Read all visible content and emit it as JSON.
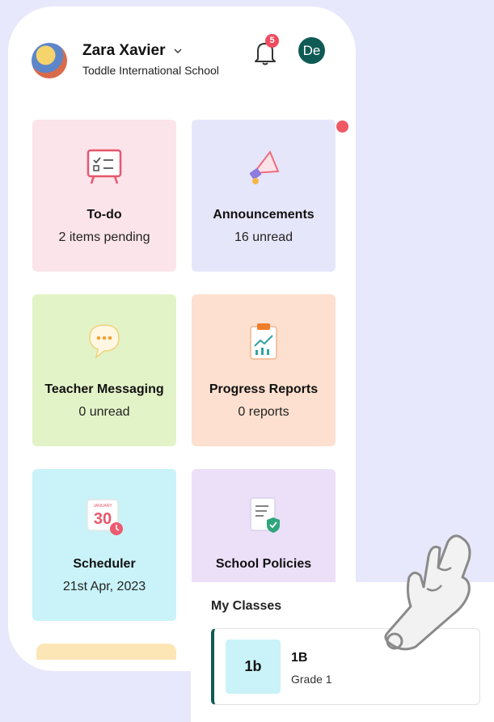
{
  "header": {
    "user_name": "Zara Xavier",
    "school_name": "Toddle International School",
    "notification_count": "5",
    "user_initials": "De"
  },
  "tiles": [
    {
      "title": "To-do",
      "subtitle": "2 items pending",
      "icon": "todo-board-icon"
    },
    {
      "title": "Announcements",
      "subtitle": "16 unread",
      "icon": "megaphone-icon"
    },
    {
      "title": "Teacher Messaging",
      "subtitle": "0 unread",
      "icon": "chat-bubble-icon"
    },
    {
      "title": "Progress Reports",
      "subtitle": "0 reports",
      "icon": "report-chart-icon"
    },
    {
      "title": "Scheduler",
      "subtitle": "21st Apr, 2023",
      "icon": "calendar-icon"
    },
    {
      "title": "School Policies",
      "subtitle": "",
      "icon": "policy-document-icon"
    }
  ],
  "calendar_icon": {
    "month": "JANUARY",
    "day": "30"
  },
  "my_classes": {
    "title": "My Classes",
    "classes": [
      {
        "thumb": "1b",
        "name": "1B",
        "grade": "Grade 1"
      }
    ]
  },
  "colors": {
    "accent": "#0f5a55",
    "badge": "#ee4d5f",
    "todo": "#fbe4ea",
    "announcements": "#e6e6fb",
    "messaging": "#e3f3c8",
    "reports": "#fde0cf",
    "scheduler": "#c9f3f8",
    "policies": "#ece0f8"
  }
}
